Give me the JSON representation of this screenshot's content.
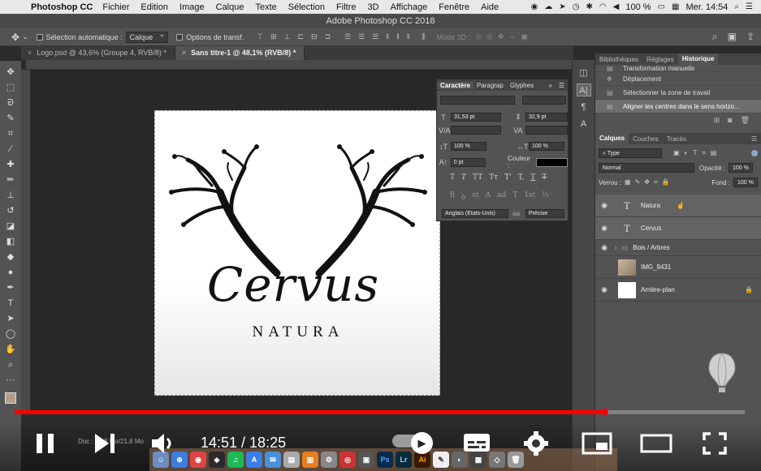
{
  "menubar": {
    "app_name": "Photoshop CC",
    "menus": [
      "Fichier",
      "Edition",
      "Image",
      "Calque",
      "Texte",
      "Sélection",
      "Filtre",
      "3D",
      "Affichage",
      "Fenêtre",
      "Aide"
    ],
    "battery": "100 %",
    "clock": "Mer. 14:54"
  },
  "window_title": "Adobe Photoshop CC 2018",
  "options_bar": {
    "auto_select_label": "Sélection automatique :",
    "auto_select_value": "Calque",
    "transform_label": "Options de transf.",
    "mode3d_label": "Mode 3D :"
  },
  "doc_tabs": [
    {
      "label": "Logo.psd @ 43,6% (Groupe 4, RVB/8) *",
      "active": false
    },
    {
      "label": "Sans titre-1 @ 48,1% (RVB/8) *",
      "active": true
    }
  ],
  "artboard": {
    "script_text": "Cervus",
    "sub_text": "NATURA"
  },
  "character_panel": {
    "tabs": [
      "Caractère",
      "Paragrap",
      "Glyphes"
    ],
    "font_size": "31,53 pt",
    "leading": "32,9 pt",
    "vscale": "100 %",
    "hscale": "100 %",
    "baseline": "0 pt",
    "color_label": "Couleur :",
    "language": "Anglais (Etats-Unis)",
    "antialias": "Précise",
    "aa_label": "aa",
    "styles": [
      "T",
      "T",
      "TT",
      "Tт",
      "T'",
      "T,",
      "T",
      "T"
    ],
    "opentype": [
      "fi",
      "ꝺ",
      "st",
      "A",
      "ad",
      "T",
      "1st",
      "½"
    ]
  },
  "right_panel": {
    "top_tabs": [
      "Bibliothèques",
      "Réglages",
      "Historique"
    ],
    "history": [
      {
        "label": "Transformation manuelle",
        "selected": false
      },
      {
        "label": "Déplacement",
        "selected": false
      },
      {
        "label": "Sélectionner la zone de travail",
        "selected": false
      },
      {
        "label": "Aligner les centres dans le sens horizo...",
        "selected": true
      }
    ],
    "layer_tabs": [
      "Calques",
      "Couches",
      "Tracés"
    ],
    "filter_type": "Type",
    "blend_mode": "Normal",
    "opacity_label": "Opacité :",
    "opacity_value": "100 %",
    "lock_label": "Verrou :",
    "fill_label": "Fond :",
    "fill_value": "100 %",
    "layers": [
      {
        "name": "Natura",
        "kind": "text",
        "visible": true,
        "highlight": true
      },
      {
        "name": "Cervus",
        "kind": "text",
        "visible": true,
        "highlight": true
      },
      {
        "name": "Bois / Arbres",
        "kind": "group",
        "visible": true,
        "highlight": false
      },
      {
        "name": "IMG_9431",
        "kind": "image",
        "visible": false,
        "highlight": false
      },
      {
        "name": "Arrière-plan",
        "kind": "background",
        "visible": true,
        "highlight": false
      }
    ]
  },
  "video": {
    "time": "14:51 / 18:25",
    "progress": 0.8085,
    "doc_info": "Doc : 21,8 Mo/21,8 Mo"
  },
  "dock_apps": [
    "Ps",
    "Lr",
    "Ai"
  ]
}
